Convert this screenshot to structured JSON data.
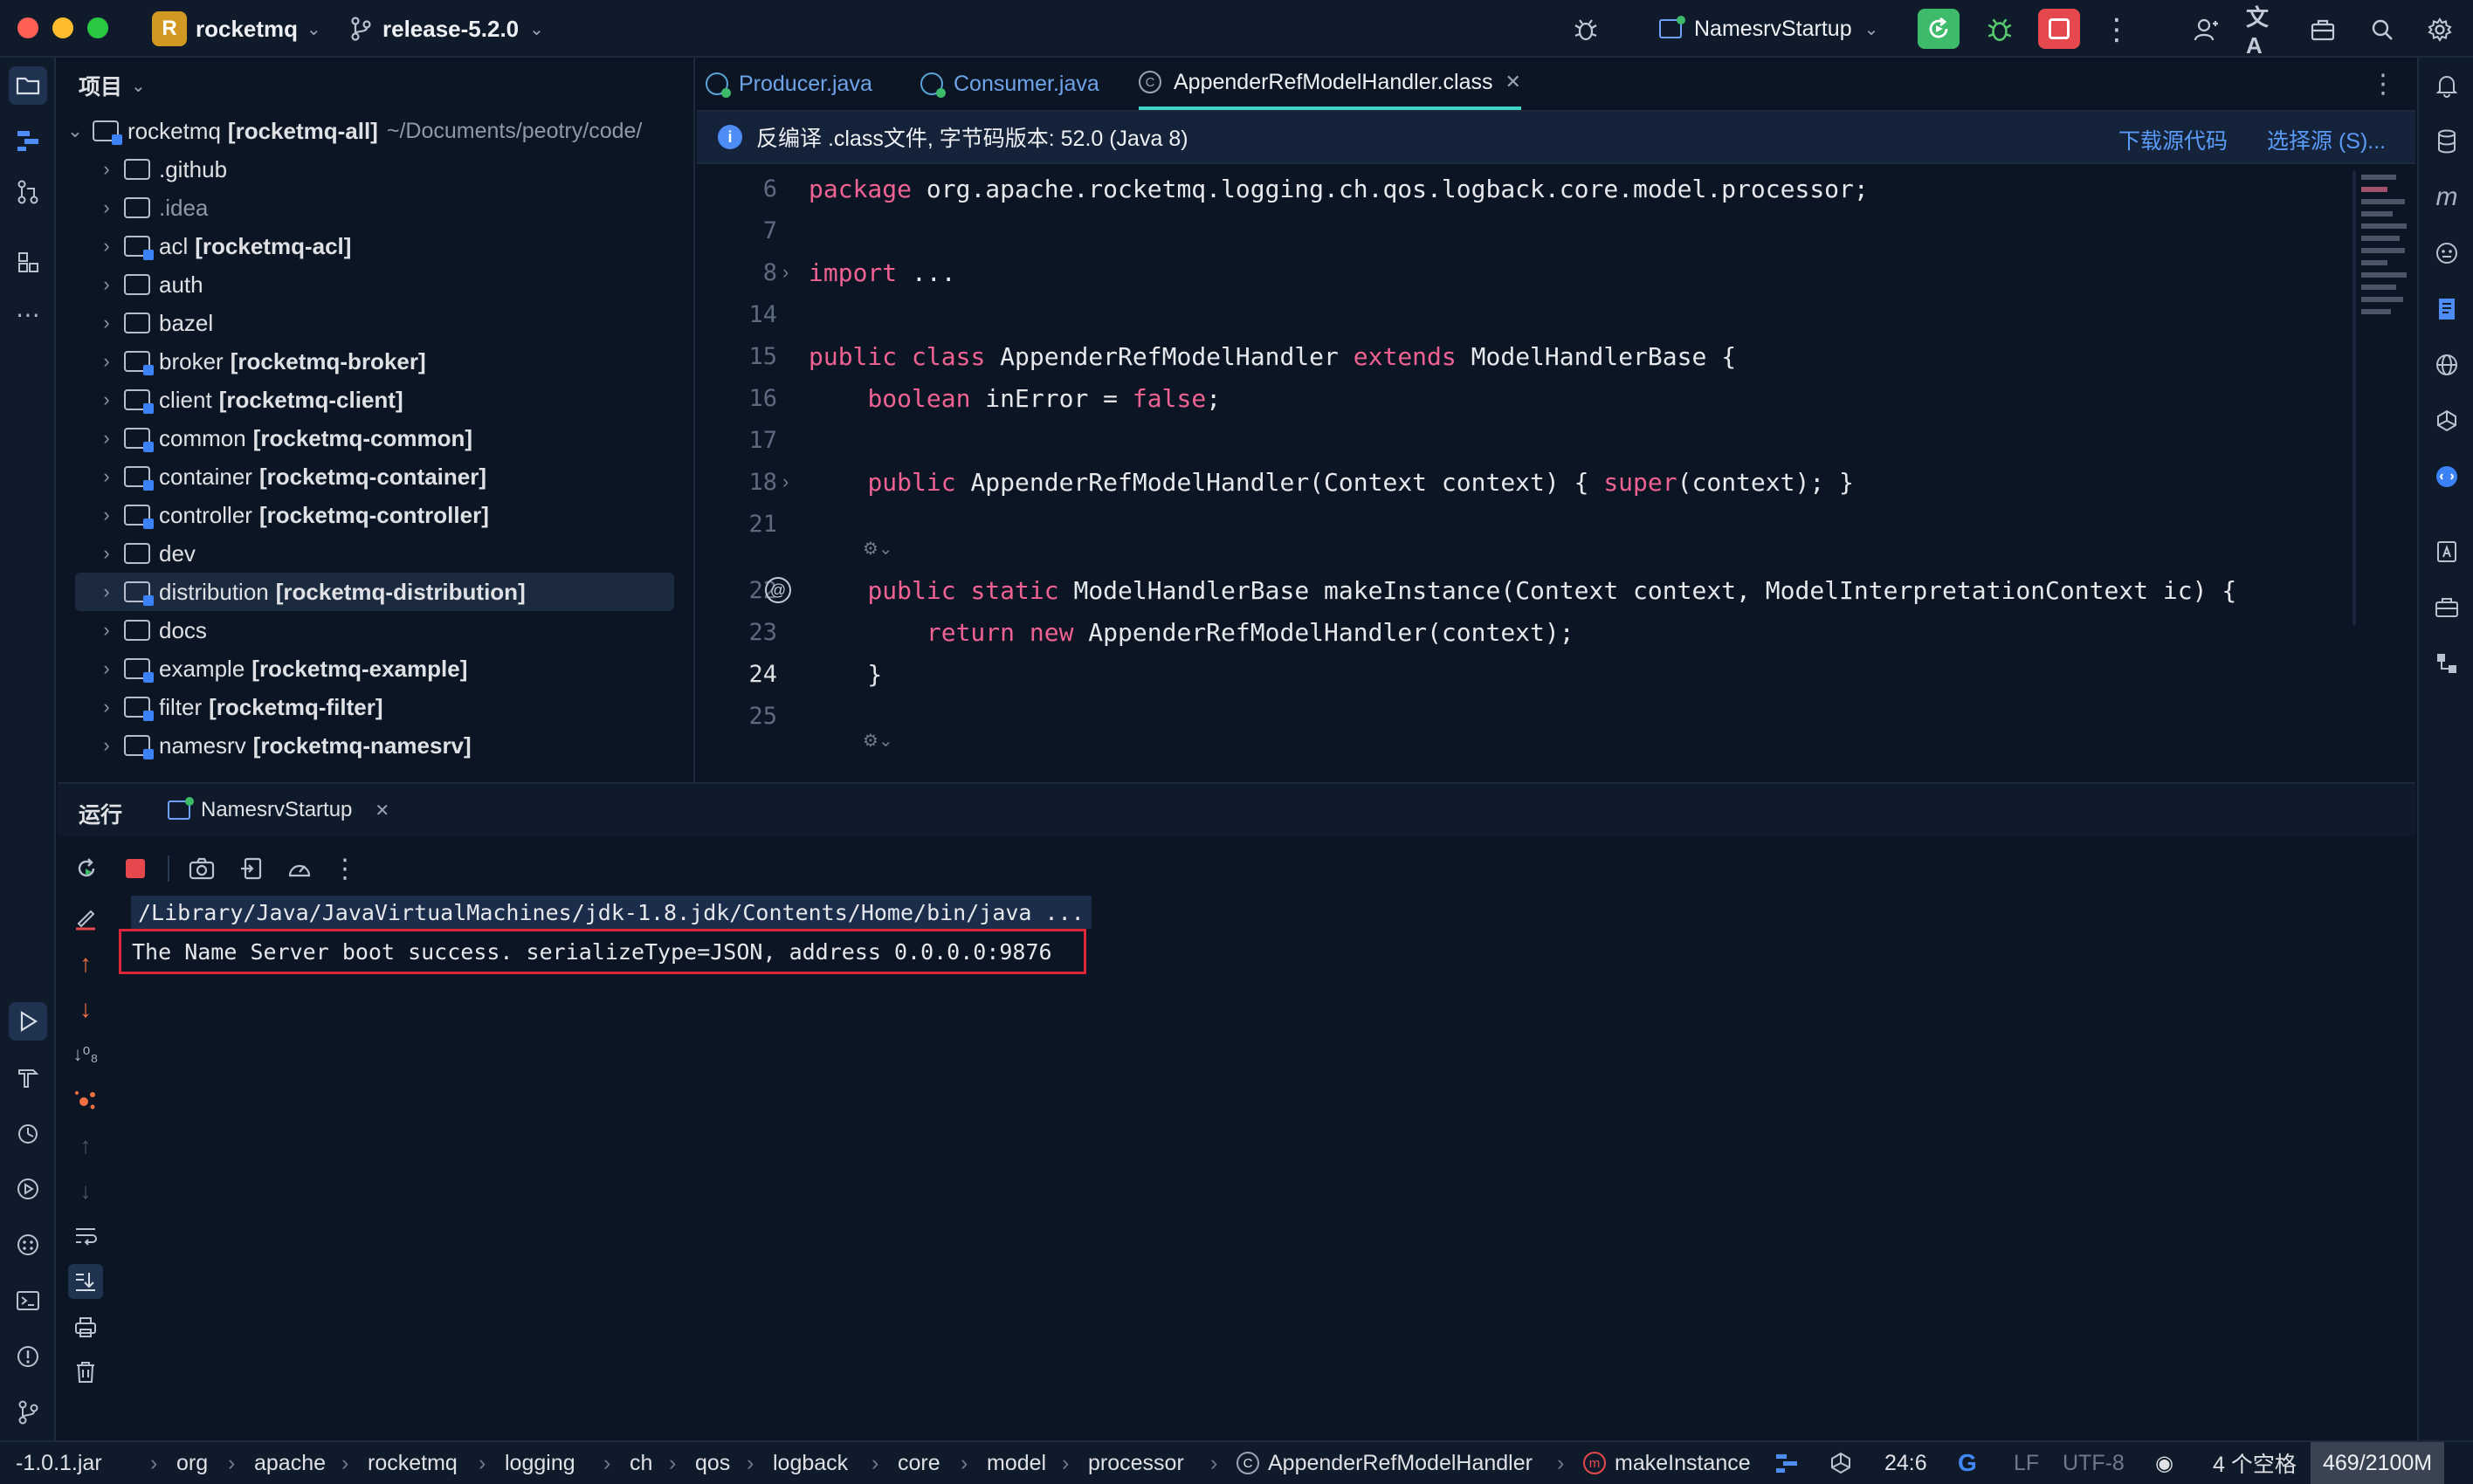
{
  "window": {
    "project_badge": "R",
    "project_name": "rocketmq",
    "branch": "release-5.2.0",
    "run_config": "NamesrvStartup"
  },
  "project_panel": {
    "title": "项目",
    "root": {
      "name": "rocketmq",
      "module": "[rocketmq-all]",
      "path": "~/Documents/peotry/code/"
    },
    "items": [
      {
        "name": ".github",
        "module": ""
      },
      {
        "name": ".idea",
        "module": ""
      },
      {
        "name": "acl",
        "module": "[rocketmq-acl]"
      },
      {
        "name": "auth",
        "module": ""
      },
      {
        "name": "bazel",
        "module": ""
      },
      {
        "name": "broker",
        "module": "[rocketmq-broker]"
      },
      {
        "name": "client",
        "module": "[rocketmq-client]"
      },
      {
        "name": "common",
        "module": "[rocketmq-common]"
      },
      {
        "name": "container",
        "module": "[rocketmq-container]"
      },
      {
        "name": "controller",
        "module": "[rocketmq-controller]"
      },
      {
        "name": "dev",
        "module": ""
      },
      {
        "name": "distribution",
        "module": "[rocketmq-distribution]"
      },
      {
        "name": "docs",
        "module": ""
      },
      {
        "name": "example",
        "module": "[rocketmq-example]"
      },
      {
        "name": "filter",
        "module": "[rocketmq-filter]"
      },
      {
        "name": "namesrv",
        "module": "[rocketmq-namesrv]"
      }
    ]
  },
  "editor": {
    "tabs": [
      "Producer.java",
      "Consumer.java",
      "AppenderRefModelHandler.class"
    ],
    "banner": {
      "text": "反编译 .class文件, 字节码版本: 52.0 (Java 8)",
      "download": "下载源代码",
      "choose": "选择源 (S)..."
    },
    "lines": [
      {
        "n": "6",
        "t": "package org.apache.rocketmq.logging.ch.qos.logback.core.model.processor;"
      },
      {
        "n": "7",
        "t": ""
      },
      {
        "n": "8",
        "t": "import ..."
      },
      {
        "n": "14",
        "t": ""
      },
      {
        "n": "15",
        "t": "public class AppenderRefModelHandler extends ModelHandlerBase {"
      },
      {
        "n": "16",
        "t": "    boolean inError = false;"
      },
      {
        "n": "17",
        "t": ""
      },
      {
        "n": "18",
        "t": "    public AppenderRefModelHandler(Context context) { super(context); }"
      },
      {
        "n": "21",
        "t": ""
      },
      {
        "n": "22",
        "t": "    public static ModelHandlerBase makeInstance(Context context, ModelInterpretationContext ic) {"
      },
      {
        "n": "23",
        "t": "        return new AppenderRefModelHandler(context);"
      },
      {
        "n": "24",
        "t": "    }"
      },
      {
        "n": "25",
        "t": ""
      }
    ]
  },
  "run_panel": {
    "title": "运行",
    "tab": "NamesrvStartup",
    "console": [
      "/Library/Java/JavaVirtualMachines/jdk-1.8.jdk/Contents/Home/bin/java ...",
      "The Name Server boot success. serializeType=JSON, address 0.0.0.0:9876"
    ]
  },
  "statusbar": {
    "breadcrumbs": [
      "-1.0.1.jar",
      "org",
      "apache",
      "rocketmq",
      "logging",
      "ch",
      "qos",
      "logback",
      "core",
      "model",
      "processor",
      "AppenderRefModelHandler",
      "makeInstance"
    ],
    "position": "24:6",
    "line_ending": "LF",
    "encoding": "UTF-8",
    "indent": "4 个空格",
    "memory": "469/2100M"
  },
  "colors": {
    "background": "#0b1524",
    "keyword": "#f06292",
    "accent_green": "#3dba6a",
    "stop_red": "#e5484d",
    "link_blue": "#5b9bf8",
    "highlight_box": "#e0263b"
  }
}
